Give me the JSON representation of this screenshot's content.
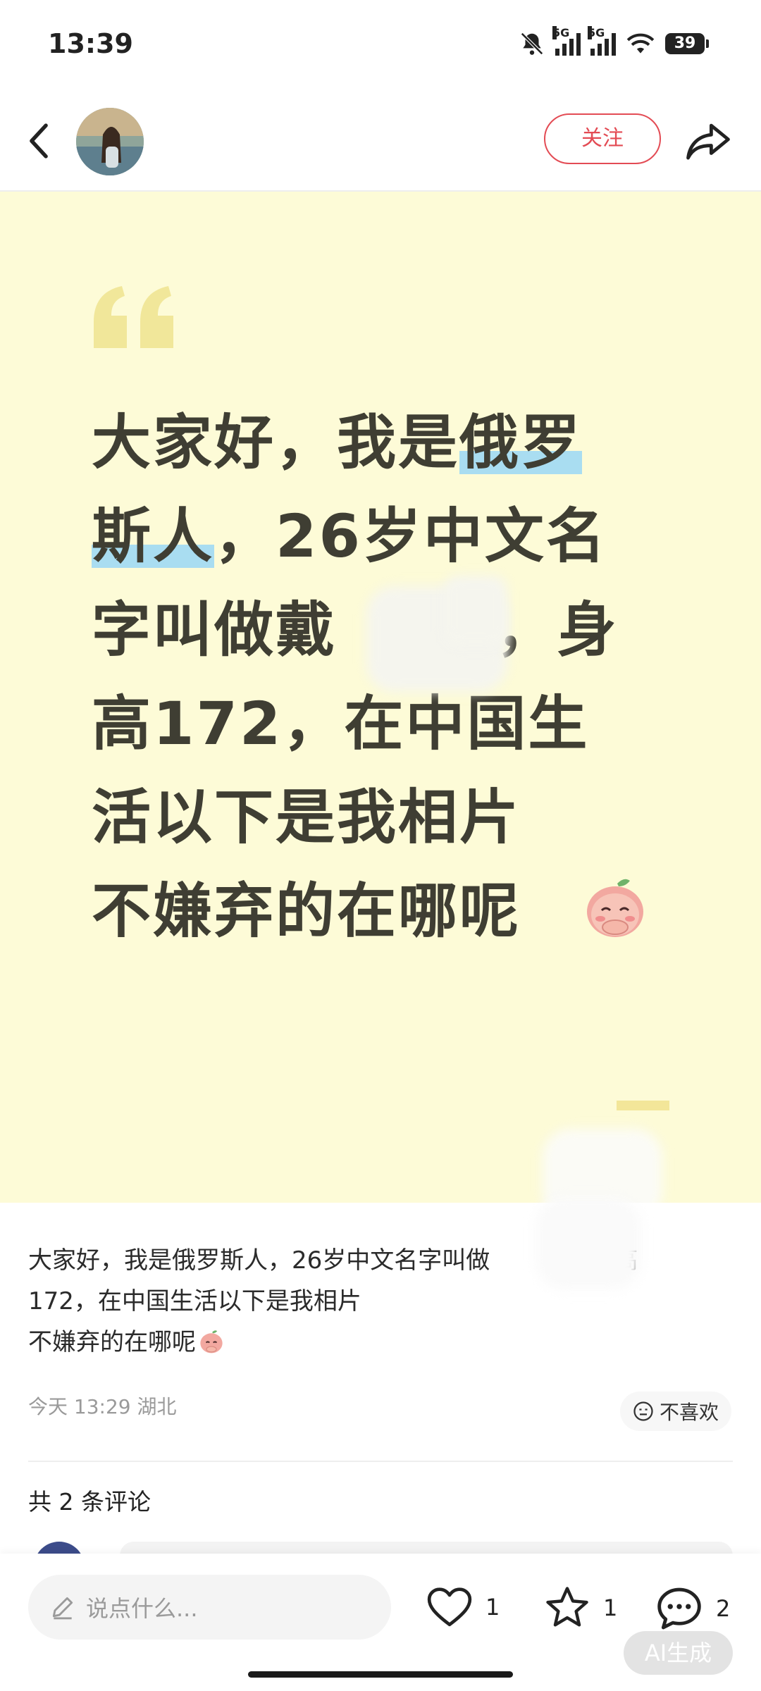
{
  "status_bar": {
    "time": "13:39",
    "battery": "39",
    "signal_tag": "5G"
  },
  "header": {
    "follow_label": "关注"
  },
  "post": {
    "big_text": {
      "line1a": "大家好，我是",
      "line1b": "俄罗",
      "line2a": "斯人",
      "line2b": "，26岁中文名",
      "line3": "字叫做戴       ，身",
      "line4": "高172，在中国生",
      "line5": "活以下是我相片",
      "line6": "不嫌弃的在哪呢"
    },
    "description": {
      "line1": "大家好，我是俄罗斯人，26岁中文名字叫做          ，身高",
      "line2": "172，在中国生活以下是我相片",
      "line3": "不嫌弃的在哪呢"
    },
    "meta": "今天 13:29 湖北",
    "dislike_label": "不喜欢",
    "comments_count": "共 2 条评论"
  },
  "bottom_bar": {
    "input_placeholder": "说点什么...",
    "like_count": "1",
    "favorite_count": "1",
    "comment_count": "2",
    "ai_label": "AI生成"
  },
  "colors": {
    "accent": "#e34b54",
    "card_bg": "#fdfbd7",
    "highlight": "#a9ddf1",
    "text_dark": "#3f3e33"
  }
}
